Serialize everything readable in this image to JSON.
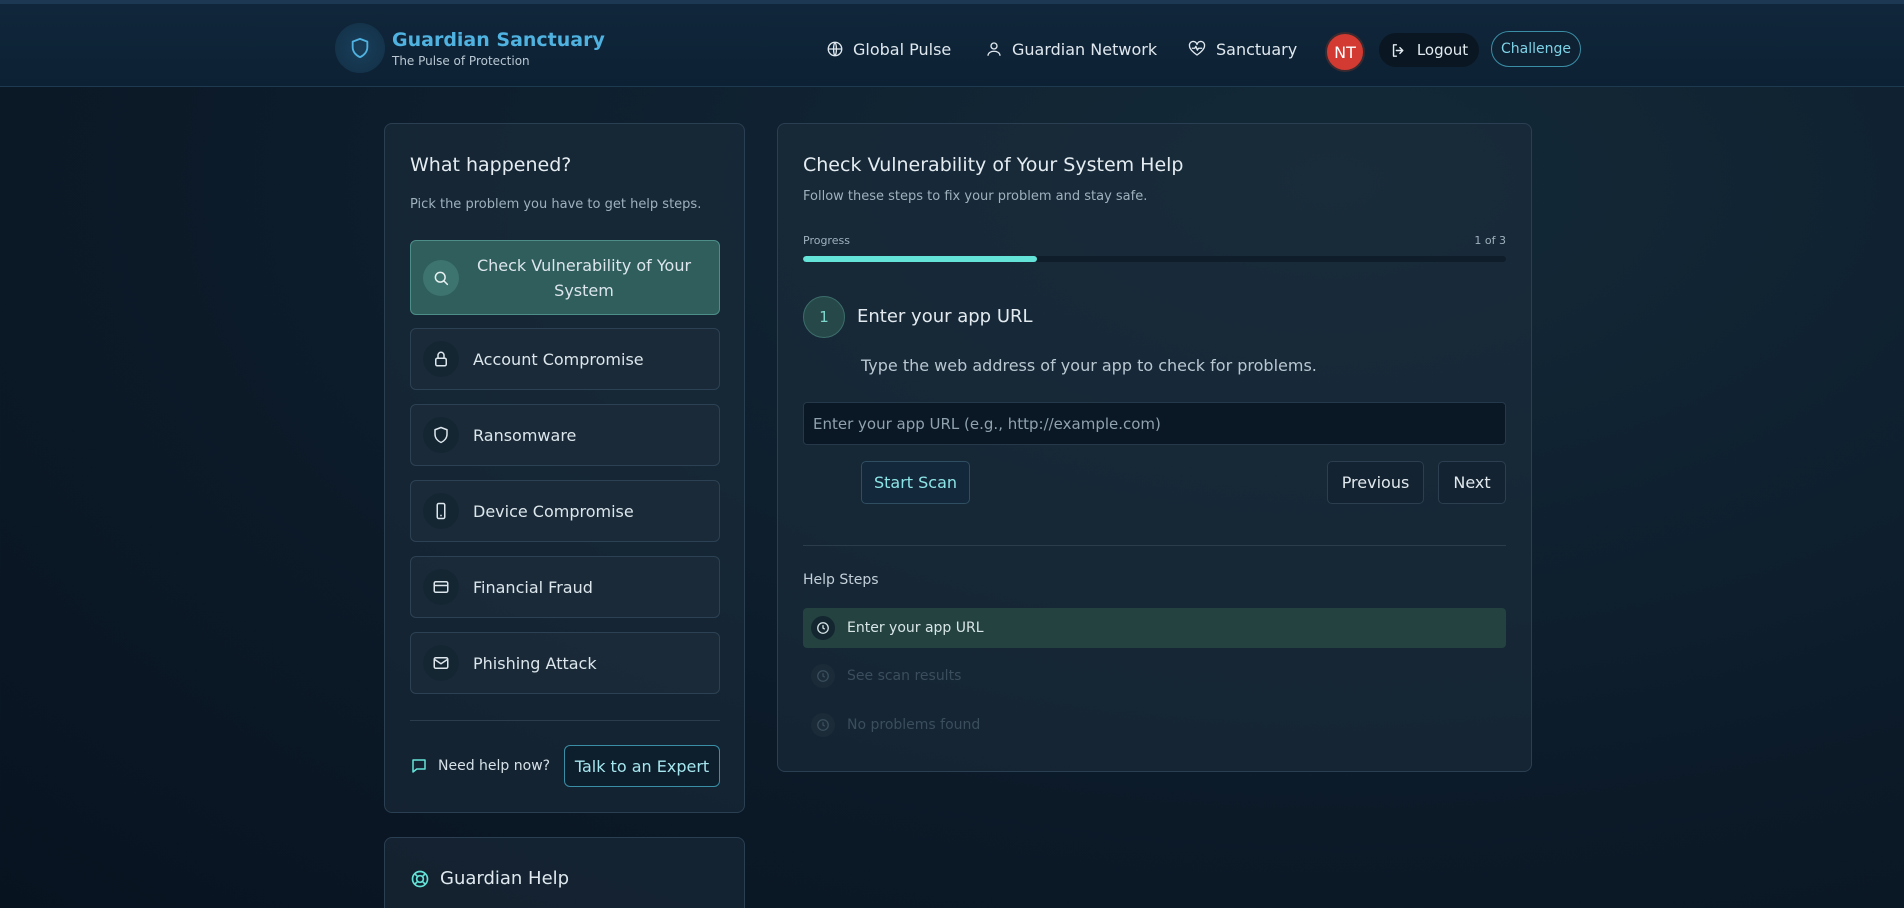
{
  "header": {
    "brand_title": "Guardian Sanctuary",
    "brand_subtitle": "The Pulse of Protection",
    "nav": [
      {
        "label": "Global Pulse",
        "icon": "globe-icon"
      },
      {
        "label": "Guardian Network",
        "icon": "user-icon"
      },
      {
        "label": "Sanctuary",
        "icon": "heart-pulse-icon"
      }
    ],
    "avatar_initials": "NT",
    "logout_label": "Logout",
    "challenge_label": "Challenge"
  },
  "sidebar": {
    "title": "What happened?",
    "subtitle": "Pick the problem you have to get help steps.",
    "problems": [
      {
        "label": "Check Vulnerability of Your System",
        "icon": "search-icon",
        "active": true
      },
      {
        "label": "Account Compromise",
        "icon": "lock-icon",
        "active": false
      },
      {
        "label": "Ransomware",
        "icon": "shield-icon",
        "active": false
      },
      {
        "label": "Device Compromise",
        "icon": "phone-icon",
        "active": false
      },
      {
        "label": "Financial Fraud",
        "icon": "credit-card-icon",
        "active": false
      },
      {
        "label": "Phishing Attack",
        "icon": "mail-icon",
        "active": false
      }
    ],
    "need_help_label": "Need help now?",
    "expert_button_label": "Talk to an Expert"
  },
  "guardian_help": {
    "title": "Guardian Help"
  },
  "main": {
    "title": "Check Vulnerability of Your System Help",
    "subtitle": "Follow these steps to fix your problem and stay safe.",
    "progress_label": "Progress",
    "progress_count": "1 of 3",
    "progress_fraction": 0.3333,
    "step_number": "1",
    "step_title": "Enter your app URL",
    "step_description": "Type the web address of your app to check for problems.",
    "url_input": {
      "value": "",
      "placeholder": "Enter your app URL (e.g., http://example.com)"
    },
    "start_scan_label": "Start Scan",
    "previous_label": "Previous",
    "next_label": "Next",
    "help_steps_label": "Help Steps",
    "help_steps": [
      {
        "label": "Enter your app URL",
        "status": "active"
      },
      {
        "label": "See scan results",
        "status": "pending"
      },
      {
        "label": "No problems found",
        "status": "pending"
      }
    ]
  },
  "colors": {
    "accent": "#64e3d8",
    "brand": "#4fb2e0",
    "avatar": "#d23a32"
  }
}
